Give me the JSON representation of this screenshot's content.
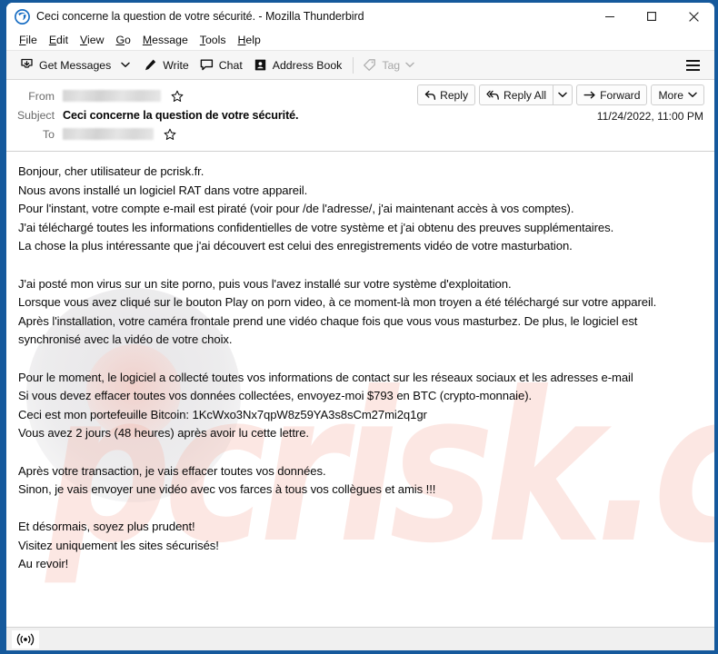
{
  "window": {
    "title": "Ceci concerne la question de votre sécurité. - Mozilla Thunderbird",
    "app_icon": "thunderbird-icon",
    "border_color": "#15599c",
    "controls": {
      "minimize": "minimize-icon",
      "maximize": "maximize-icon",
      "close": "close-icon"
    }
  },
  "menubar": {
    "items": [
      {
        "label": "File",
        "accel": "F"
      },
      {
        "label": "Edit",
        "accel": "E"
      },
      {
        "label": "View",
        "accel": "V"
      },
      {
        "label": "Go",
        "accel": "G"
      },
      {
        "label": "Message",
        "accel": "M"
      },
      {
        "label": "Tools",
        "accel": "T"
      },
      {
        "label": "Help",
        "accel": "H"
      }
    ]
  },
  "toolbar": {
    "get_messages": "Get Messages",
    "get_messages_icon": "inbox-download-icon",
    "get_messages_chevron": "chevron-down-icon",
    "write": "Write",
    "write_icon": "pencil-icon",
    "chat": "Chat",
    "chat_icon": "speech-bubble-icon",
    "address_book": "Address Book",
    "address_book_icon": "contact-card-icon",
    "tag": "Tag",
    "tag_icon": "tag-icon",
    "tag_chevron": "chevron-down-icon",
    "tag_disabled": true,
    "app_menu_icon": "hamburger-icon"
  },
  "message_header": {
    "from_label": "From",
    "from_value": "",
    "from_redacted": true,
    "subject_label": "Subject",
    "subject_value": "Ceci concerne la question de votre sécurité.",
    "to_label": "To",
    "to_value": "",
    "to_redacted": true,
    "star_icon": "star-outline-icon",
    "date": "11/24/2022, 11:00 PM",
    "actions": {
      "reply": "Reply",
      "reply_icon": "reply-arrow-icon",
      "reply_all": "Reply All",
      "reply_all_icon": "reply-all-arrow-icon",
      "reply_all_chevron": "chevron-down-icon",
      "forward": "Forward",
      "forward_icon": "forward-arrow-icon",
      "more": "More",
      "more_chevron": "chevron-down-icon"
    }
  },
  "message_body": {
    "watermark_text": "pcrisk.com",
    "watermark_color": "#f6b9ad",
    "paragraphs": [
      "Bonjour, cher utilisateur de pcrisk.fr.",
      "Nous avons installé un logiciel RAT dans votre appareil.",
      "Pour l'instant, votre compte e-mail est piraté (voir pour /de l'adresse/, j'ai maintenant accès à vos comptes).",
      "J'ai téléchargé toutes les informations confidentielles de votre système et j'ai obtenu des preuves supplémentaires.",
      "La chose la plus intéressante que j'ai découvert est celui des enregistrements vidéo de votre masturbation.",
      "",
      "J'ai posté mon virus sur un site porno, puis vous l'avez installé sur votre système d'exploitation.",
      "Lorsque vous avez cliqué sur le bouton Play on porn video, à ce moment-là mon troyen a été téléchargé sur votre appareil.",
      "Après l'installation, votre caméra frontale prend une vidéo chaque fois que vous vous masturbez. De plus, le logiciel est synchronisé avec la vidéo de votre choix.",
      "",
      "Pour le moment, le logiciel a collecté toutes vos informations de contact sur les réseaux sociaux et les adresses e-mail",
      "Si vous devez effacer toutes vos données collectées, envoyez-moi $793 en BTC (crypto-monnaie).",
      "Ceci est mon portefeuille Bitcoin: 1KcWxo3Nx7qpW8z59YA3s8sCm27mi2q1gr",
      "Vous avez 2 jours (48 heures) après avoir lu cette lettre.",
      "",
      "Après votre transaction, je vais effacer toutes vos données.",
      "Sinon, je vais envoyer une vidéo avec vos farces à tous vos collègues et amis !!!",
      "",
      "Et désormais, soyez plus prudent!",
      "Visitez uniquement les sites sécurisés!",
      "Au revoir!"
    ],
    "ransom_amount": "$793",
    "bitcoin_wallet": "1KcWxo3Nx7qpW8z59YA3s8sCm27mi2q1gr",
    "deadline": "2 jours (48 heures)"
  },
  "statusbar": {
    "icon": "connection-broadcast-icon",
    "text": ""
  }
}
